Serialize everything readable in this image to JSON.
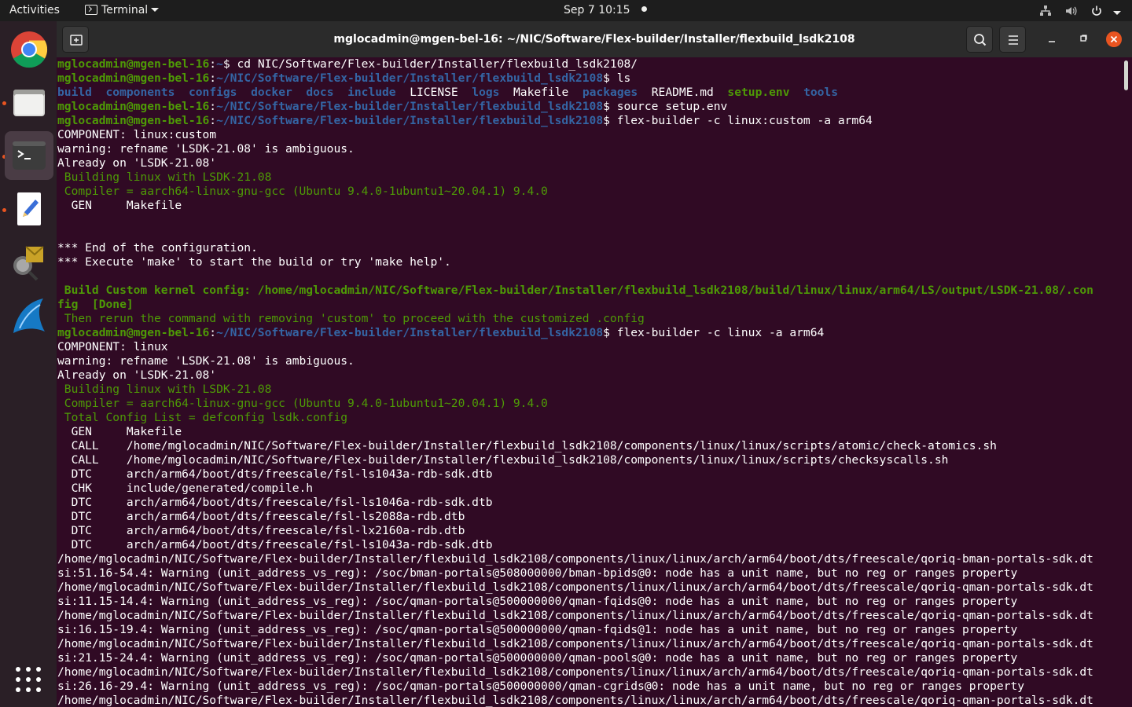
{
  "topbar": {
    "activities": "Activities",
    "app_menu": "Terminal",
    "clock": "Sep 7  10:15"
  },
  "dock": {
    "items": [
      "chrome-icon",
      "files-icon",
      "terminal-icon",
      "text-editor-icon",
      "network-tool-icon",
      "wireshark-icon"
    ]
  },
  "window": {
    "title": "mglocadmin@mgen-bel-16: ~/NIC/Software/Flex-builder/Installer/flexbuild_lsdk2108"
  },
  "terminal": {
    "user_host": "mglocadmin@mgen-bel-16",
    "lines": [
      {
        "type": "prompt",
        "path": "~",
        "cmd": " cd NIC/Software/Flex-builder/Installer/flexbuild_lsdk2108/"
      },
      {
        "type": "prompt",
        "path": "~/NIC/Software/Flex-builder/Installer/flexbuild_lsdk2108",
        "cmd": " ls"
      },
      {
        "type": "ls",
        "items": [
          {
            "name": "build",
            "kind": "dir"
          },
          {
            "name": "components",
            "kind": "dir"
          },
          {
            "name": "configs",
            "kind": "dir"
          },
          {
            "name": "docker",
            "kind": "dir"
          },
          {
            "name": "docs",
            "kind": "dir"
          },
          {
            "name": "include",
            "kind": "dir"
          },
          {
            "name": "LICENSE",
            "kind": "file"
          },
          {
            "name": "logs",
            "kind": "dir"
          },
          {
            "name": "Makefile",
            "kind": "file"
          },
          {
            "name": "packages",
            "kind": "dir"
          },
          {
            "name": "README.md",
            "kind": "file"
          },
          {
            "name": "setup.env",
            "kind": "exec"
          },
          {
            "name": "tools",
            "kind": "dir"
          }
        ]
      },
      {
        "type": "prompt",
        "path": "~/NIC/Software/Flex-builder/Installer/flexbuild_lsdk2108",
        "cmd": " source setup.env"
      },
      {
        "type": "prompt",
        "path": "~/NIC/Software/Flex-builder/Installer/flexbuild_lsdk2108",
        "cmd": " flex-builder -c linux:custom -a arm64"
      },
      {
        "type": "out",
        "text": "COMPONENT: linux:custom"
      },
      {
        "type": "out",
        "text": "warning: refname 'LSDK-21.08' is ambiguous."
      },
      {
        "type": "out",
        "text": "Already on 'LSDK-21.08'"
      },
      {
        "type": "green",
        "text": " Building linux with LSDK-21.08"
      },
      {
        "type": "green",
        "text": " Compiler = aarch64-linux-gnu-gcc (Ubuntu 9.4.0-1ubuntu1~20.04.1) 9.4.0"
      },
      {
        "type": "out",
        "text": "  GEN     Makefile"
      },
      {
        "type": "out",
        "text": ""
      },
      {
        "type": "out",
        "text": ""
      },
      {
        "type": "out",
        "text": "*** End of the configuration."
      },
      {
        "type": "out",
        "text": "*** Execute 'make' to start the build or try 'make help'."
      },
      {
        "type": "out",
        "text": ""
      },
      {
        "type": "greenbold",
        "text": " Build Custom kernel config: /home/mglocadmin/NIC/Software/Flex-builder/Installer/flexbuild_lsdk2108/build/linux/linux/arm64/LS/output/LSDK-21.08/.con"
      },
      {
        "type": "greenbold",
        "text": "fig  [Done]"
      },
      {
        "type": "green",
        "text": " Then rerun the command with removing 'custom' to proceed with the customized .config"
      },
      {
        "type": "prompt",
        "path": "~/NIC/Software/Flex-builder/Installer/flexbuild_lsdk2108",
        "cmd": " flex-builder -c linux -a arm64"
      },
      {
        "type": "out",
        "text": "COMPONENT: linux"
      },
      {
        "type": "out",
        "text": "warning: refname 'LSDK-21.08' is ambiguous."
      },
      {
        "type": "out",
        "text": "Already on 'LSDK-21.08'"
      },
      {
        "type": "green",
        "text": " Building linux with LSDK-21.08"
      },
      {
        "type": "green",
        "text": " Compiler = aarch64-linux-gnu-gcc (Ubuntu 9.4.0-1ubuntu1~20.04.1) 9.4.0"
      },
      {
        "type": "green",
        "text": " Total Config List = defconfig lsdk.config"
      },
      {
        "type": "out",
        "text": "  GEN     Makefile"
      },
      {
        "type": "out",
        "text": "  CALL    /home/mglocadmin/NIC/Software/Flex-builder/Installer/flexbuild_lsdk2108/components/linux/linux/scripts/atomic/check-atomics.sh"
      },
      {
        "type": "out",
        "text": "  CALL    /home/mglocadmin/NIC/Software/Flex-builder/Installer/flexbuild_lsdk2108/components/linux/linux/scripts/checksyscalls.sh"
      },
      {
        "type": "out",
        "text": "  DTC     arch/arm64/boot/dts/freescale/fsl-ls1043a-rdb-sdk.dtb"
      },
      {
        "type": "out",
        "text": "  CHK     include/generated/compile.h"
      },
      {
        "type": "out",
        "text": "  DTC     arch/arm64/boot/dts/freescale/fsl-ls1046a-rdb-sdk.dtb"
      },
      {
        "type": "out",
        "text": "  DTC     arch/arm64/boot/dts/freescale/fsl-ls2088a-rdb.dtb"
      },
      {
        "type": "out",
        "text": "  DTC     arch/arm64/boot/dts/freescale/fsl-lx2160a-rdb.dtb"
      },
      {
        "type": "out",
        "text": "  DTC     arch/arm64/boot/dts/freescale/fsl-ls1043a-rdb-sdk.dtb"
      },
      {
        "type": "out",
        "text": "/home/mglocadmin/NIC/Software/Flex-builder/Installer/flexbuild_lsdk2108/components/linux/linux/arch/arm64/boot/dts/freescale/qoriq-bman-portals-sdk.dt"
      },
      {
        "type": "out",
        "text": "si:51.16-54.4: Warning (unit_address_vs_reg): /soc/bman-portals@508000000/bman-bpids@0: node has a unit name, but no reg or ranges property"
      },
      {
        "type": "out",
        "text": "/home/mglocadmin/NIC/Software/Flex-builder/Installer/flexbuild_lsdk2108/components/linux/linux/arch/arm64/boot/dts/freescale/qoriq-qman-portals-sdk.dt"
      },
      {
        "type": "out",
        "text": "si:11.15-14.4: Warning (unit_address_vs_reg): /soc/qman-portals@500000000/qman-fqids@0: node has a unit name, but no reg or ranges property"
      },
      {
        "type": "out",
        "text": "/home/mglocadmin/NIC/Software/Flex-builder/Installer/flexbuild_lsdk2108/components/linux/linux/arch/arm64/boot/dts/freescale/qoriq-qman-portals-sdk.dt"
      },
      {
        "type": "out",
        "text": "si:16.15-19.4: Warning (unit_address_vs_reg): /soc/qman-portals@500000000/qman-fqids@1: node has a unit name, but no reg or ranges property"
      },
      {
        "type": "out",
        "text": "/home/mglocadmin/NIC/Software/Flex-builder/Installer/flexbuild_lsdk2108/components/linux/linux/arch/arm64/boot/dts/freescale/qoriq-qman-portals-sdk.dt"
      },
      {
        "type": "out",
        "text": "si:21.15-24.4: Warning (unit_address_vs_reg): /soc/qman-portals@500000000/qman-pools@0: node has a unit name, but no reg or ranges property"
      },
      {
        "type": "out",
        "text": "/home/mglocadmin/NIC/Software/Flex-builder/Installer/flexbuild_lsdk2108/components/linux/linux/arch/arm64/boot/dts/freescale/qoriq-qman-portals-sdk.dt"
      },
      {
        "type": "out",
        "text": "si:26.16-29.4: Warning (unit_address_vs_reg): /soc/qman-portals@500000000/qman-cgrids@0: node has a unit name, but no reg or ranges property"
      },
      {
        "type": "out",
        "text": "/home/mglocadmin/NIC/Software/Flex-builder/Installer/flexbuild_lsdk2108/components/linux/linux/arch/arm64/boot/dts/freescale/qoriq-qman-portals-sdk.dt"
      }
    ]
  },
  "colors": {
    "terminal_bg": "#300a24",
    "prompt_user": "#4e9a06",
    "prompt_path": "#3465a4",
    "accent": "#e95420"
  }
}
